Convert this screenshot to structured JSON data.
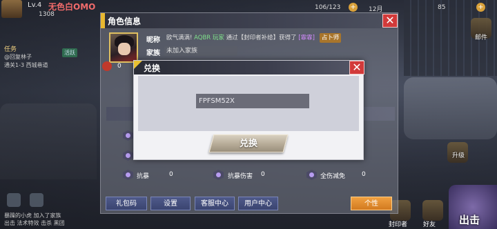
{
  "hud": {
    "level": "Lv.4",
    "player_name": "无色白OMO",
    "power": "1308",
    "stamina": "106/123",
    "date": "12月",
    "gems": "85"
  },
  "quest": {
    "title": "任务",
    "lines": [
      "@回复林子",
      "通关1-3 西城巷道"
    ],
    "badge": "活跃"
  },
  "bottom_left_text": [
    "暴躁的小虎 加入了家族",
    "出击 法术特效 击杀 黑团"
  ],
  "right_side": {
    "mail_label": "邮件",
    "seal_label": "封印者",
    "friend_label": "好友",
    "fight_label": "出击",
    "sign_label": "升级"
  },
  "info_window": {
    "title": "角色信息",
    "close_glyph": "✕",
    "rank": "0",
    "nickname_label": "昵称",
    "ticker": {
      "prefix": "欧气满满!",
      "highlight": "AQBR 玩家",
      "middle": "通过【封印者补给】获得了",
      "item": "[霏霏]",
      "tag": "占卜师"
    },
    "family_label": "家族",
    "family_value": "未加入家族",
    "stats": [
      {
        "name": "抗暴",
        "value": "0"
      },
      {
        "name": "抗暴伤害",
        "value": "0"
      },
      {
        "name": "全伤减免",
        "value": "0"
      }
    ],
    "buttons": {
      "gift_code": "礼包码",
      "settings": "设置",
      "service": "客服中心",
      "user_center": "用户中心",
      "personal": "个性"
    }
  },
  "exchange_dialog": {
    "title": "兑换",
    "close_glyph": "✕",
    "code_value": "FPFSM52X",
    "confirm_label": "兑换"
  },
  "colors": {
    "close_red": "#d23a3a",
    "title_accent": "#e8c030",
    "input_bg": "#6b6c78",
    "personal_orange": "#f0a040"
  }
}
